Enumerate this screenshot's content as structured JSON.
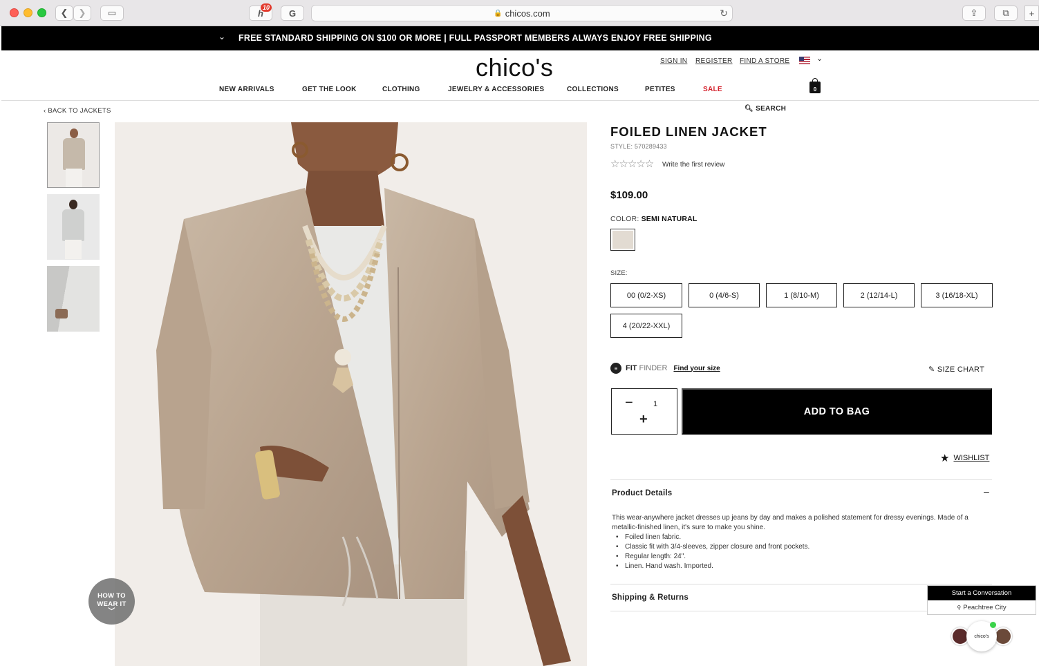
{
  "browser": {
    "url": "chicos.com",
    "extension_badge": "10"
  },
  "promo": {
    "text": "FREE STANDARD SHIPPING ON $100 OR MORE | FULL PASSPORT MEMBERS ALWAYS ENJOY FREE SHIPPING"
  },
  "header": {
    "logo": "chico's",
    "sign_in": "SIGN IN",
    "register": "REGISTER",
    "find_store": "FIND A STORE",
    "bag_count": "0",
    "nav": [
      "NEW ARRIVALS",
      "GET THE LOOK",
      "CLOTHING",
      "JEWELRY & ACCESSORIES",
      "COLLECTIONS",
      "PETITES",
      "SALE"
    ],
    "sale_color": "#d4202b"
  },
  "breadcrumb": {
    "back": "BACK TO JACKETS"
  },
  "search": {
    "label": "SEARCH"
  },
  "gallery": {
    "how_to_line1": "HOW TO",
    "how_to_line2": "WEAR IT"
  },
  "product": {
    "title": "FOILED LINEN JACKET",
    "style": "STYLE: 570289433",
    "stars": "☆☆☆☆☆",
    "review_link": "Write the first review",
    "price": "$109.00",
    "color_label": "COLOR:",
    "color_value": "SEMI NATURAL",
    "swatch_color": "#e2dbd2",
    "size_label": "SIZE:",
    "sizes": [
      "00 (0/2-XS)",
      "0 (4/6-S)",
      "1 (8/10-M)",
      "2 (12/14-L)",
      "3 (16/18-XL)",
      "4 (20/22-XXL)"
    ],
    "fit": "FIT",
    "finder": "FINDER",
    "find_size": "Find your size",
    "size_chart": "SIZE CHART",
    "quantity": "1",
    "add_to_bag": "ADD TO BAG",
    "wishlist": "WISHLIST"
  },
  "details": {
    "title": "Product Details",
    "toggle": "–",
    "description": "This wear-anywhere jacket dresses up jeans by day and makes a polished statement for dressy evenings. Made of a metallic-finished linen, it's sure to make you shine.",
    "bullets": [
      "Foiled linen fabric.",
      "Classic fit with 3/4-sleeves, zipper closure and front pockets.",
      "Regular length: 24\".",
      "Linen. Hand wash. Imported."
    ],
    "shipping_title": "Shipping & Returns"
  },
  "chat": {
    "start": "Start a Conversation",
    "location": "Peachtree City",
    "logo": "chico's"
  }
}
